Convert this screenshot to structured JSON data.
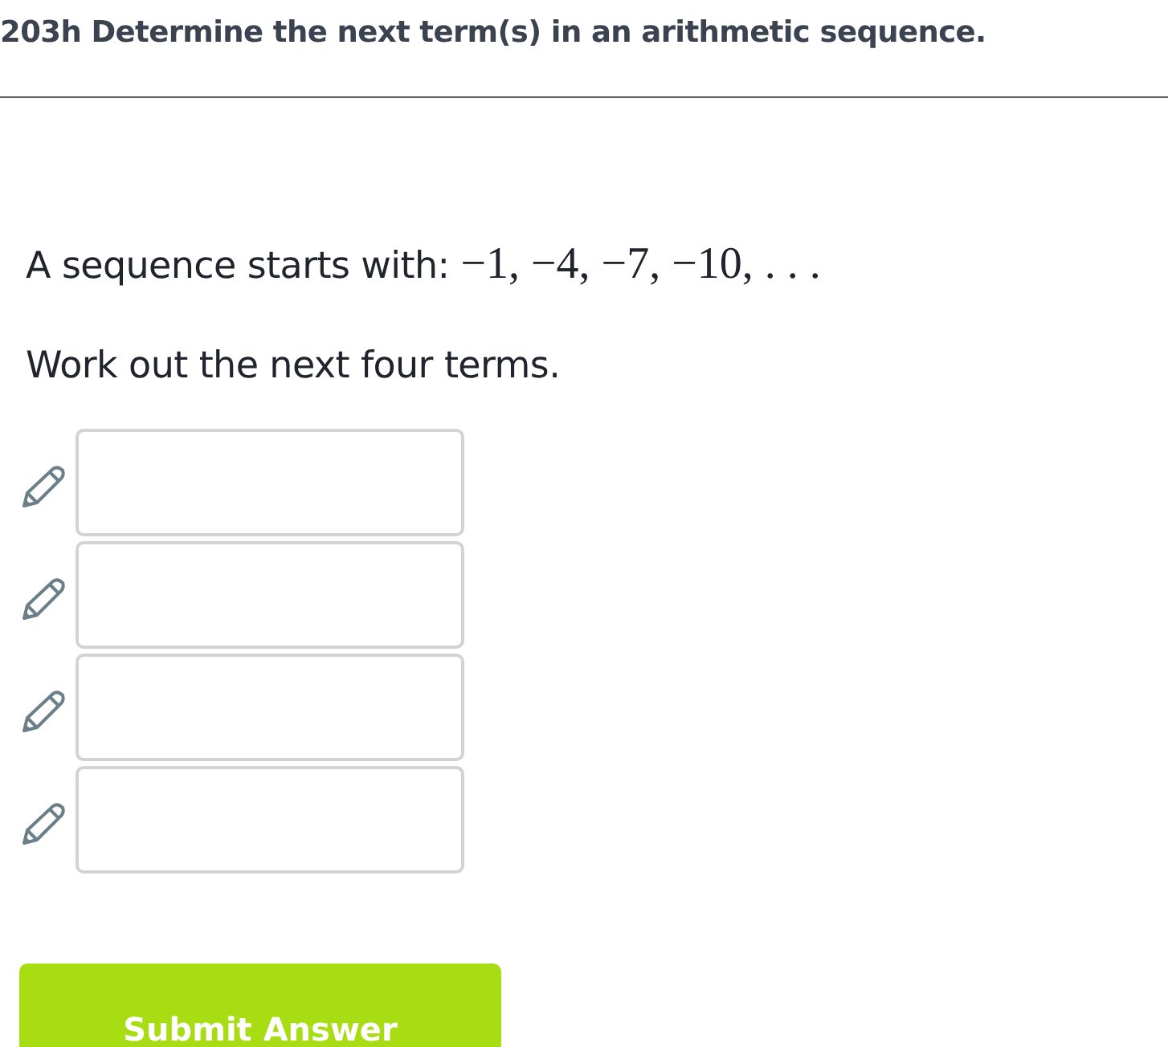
{
  "title": "203h Determine the next term(s) in an arithmetic sequence.",
  "question": {
    "text": "A sequence starts with:",
    "math": "−1, −4, −7, −10, . . ."
  },
  "instruction": "Work out the next four terms.",
  "answers": [
    {
      "kind": "text"
    },
    {
      "kind": "text"
    },
    {
      "kind": "text"
    },
    {
      "kind": "text"
    }
  ],
  "submit_button": "Submit Answer"
}
